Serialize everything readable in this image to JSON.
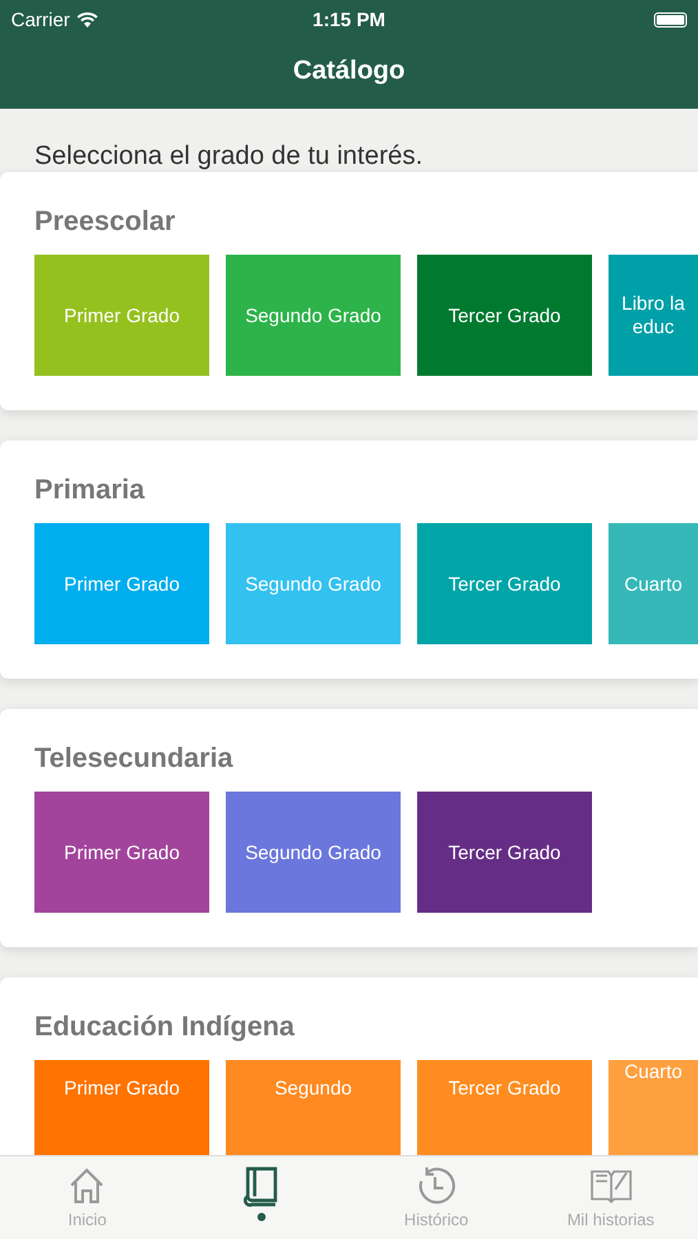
{
  "status_bar": {
    "carrier": "Carrier",
    "time": "1:15 PM"
  },
  "nav": {
    "title": "Catálogo"
  },
  "intro": "Selecciona el grado de tu interés.",
  "sections": [
    {
      "title": "Preescolar",
      "tiles": [
        {
          "label": "Primer Grado",
          "color": "#95c11f"
        },
        {
          "label": "Segundo Grado",
          "color": "#2db34a"
        },
        {
          "label": "Tercer Grado",
          "color": "#007a2f"
        },
        {
          "label": "Libro la educ",
          "color": "#00a0a8"
        }
      ]
    },
    {
      "title": "Primaria",
      "tiles": [
        {
          "label": "Primer Grado",
          "color": "#00aeef"
        },
        {
          "label": "Segundo Grado",
          "color": "#33c1f0"
        },
        {
          "label": "Tercer Grado",
          "color": "#00a5a8"
        },
        {
          "label": "Cuarto",
          "color": "#36b8b8"
        }
      ]
    },
    {
      "title": "Telesecundaria",
      "tiles": [
        {
          "label": "Primer Grado",
          "color": "#a2449c"
        },
        {
          "label": "Segundo Grado",
          "color": "#6b77dc"
        },
        {
          "label": "Tercer Grado",
          "color": "#662d87"
        }
      ]
    },
    {
      "title": "Educación Indígena",
      "tiles": [
        {
          "label": "Primer Grado",
          "color": "#ff7300"
        },
        {
          "label": "Segundo",
          "color": "#ff8a22"
        },
        {
          "label": "Tercer Grado",
          "color": "#ff8c1f"
        },
        {
          "label": "Cuarto",
          "color": "#ffa040"
        }
      ]
    }
  ],
  "tab_bar": [
    {
      "kind": "home",
      "label": "Inicio",
      "selected": false
    },
    {
      "kind": "catalog",
      "selected": true
    },
    {
      "kind": "history",
      "label": "Histórico",
      "selected": false
    },
    {
      "kind": "stories",
      "label": "Mil historias",
      "selected": false
    }
  ]
}
